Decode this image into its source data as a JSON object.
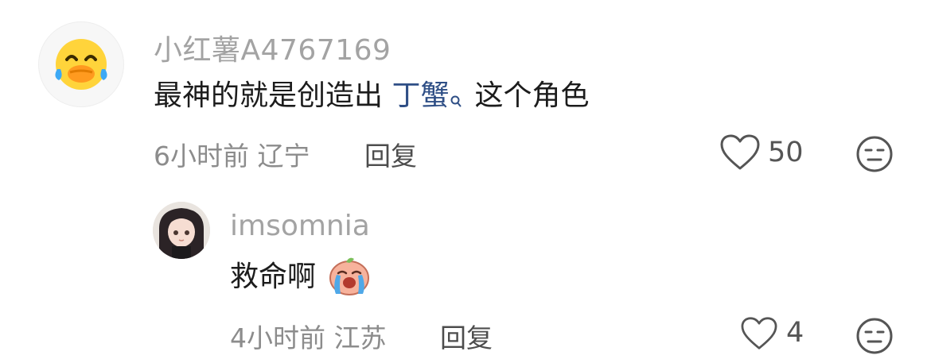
{
  "comments": [
    {
      "username": "小红薯A4767169",
      "text_before": "最神的就是创造出",
      "link": "丁蟹",
      "text_after": "这个角色",
      "time": "6小时前",
      "location": "辽宁",
      "reply_label": "回复",
      "likes": "50",
      "avatar_icon": "laughing-duck-emoji-icon"
    },
    {
      "username": "imsomnia",
      "text": "救命啊",
      "sticker_icon": "crying-peach-sticker-icon",
      "time": "4小时前",
      "location": "江苏",
      "reply_label": "回复",
      "likes": "4",
      "avatar_icon": "anime-girl-avatar"
    }
  ],
  "colors": {
    "username": "#a3a3a3",
    "body_text": "#1c1c1c",
    "link": "#2f4f86",
    "meta": "#8c8c8c",
    "reply": "#4d4d4d",
    "icon": "#555555"
  }
}
